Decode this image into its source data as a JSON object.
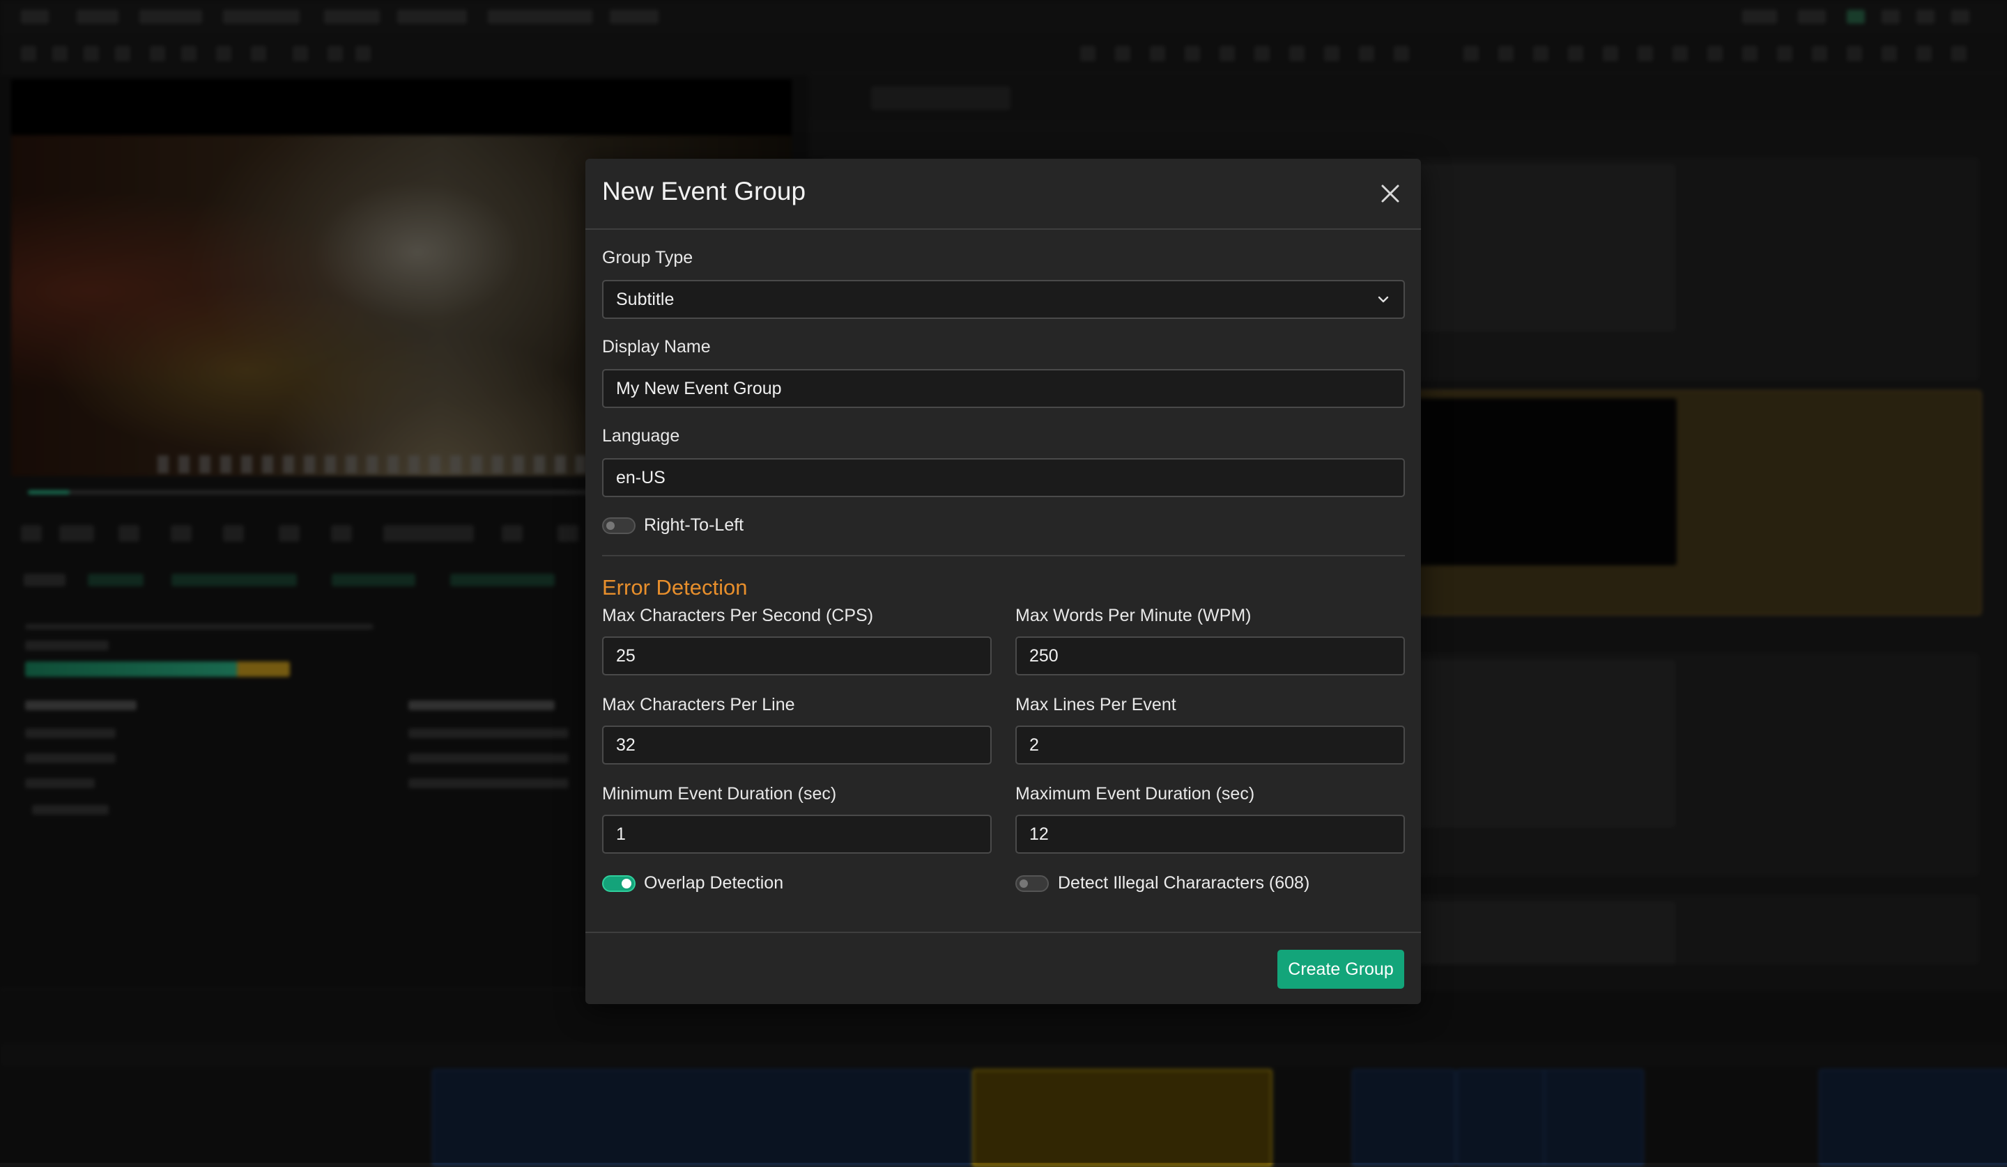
{
  "modal": {
    "title": "New Event Group",
    "group_type": {
      "label": "Group Type",
      "value": "Subtitle"
    },
    "display_name": {
      "label": "Display Name",
      "value": "My New Event Group"
    },
    "language": {
      "label": "Language",
      "value": "en-US"
    },
    "rtl": {
      "label": "Right-To-Left",
      "enabled": false
    },
    "error_detection": {
      "title": "Error Detection",
      "max_cps": {
        "label": "Max Characters Per Second (CPS)",
        "value": "25"
      },
      "max_wpm": {
        "label": "Max Words Per Minute (WPM)",
        "value": "250"
      },
      "max_cpl": {
        "label": "Max Characters Per Line",
        "value": "32"
      },
      "max_lines": {
        "label": "Max Lines Per Event",
        "value": "2"
      },
      "min_duration": {
        "label": "Minimum Event Duration (sec)",
        "value": "1"
      },
      "max_duration": {
        "label": "Maximum Event Duration (sec)",
        "value": "12"
      },
      "overlap_detection": {
        "label": "Overlap Detection",
        "enabled": true
      },
      "illegal_chars": {
        "label": "Detect Illegal Chararacters (608)",
        "enabled": false
      }
    },
    "create_label": "Create Group"
  },
  "colors": {
    "accent_green": "#13a57a",
    "section_orange": "#e88f2c",
    "modal_bg": "#262626"
  },
  "icons": {
    "close": "close-icon",
    "dropdown": "chevron-down-icon"
  }
}
